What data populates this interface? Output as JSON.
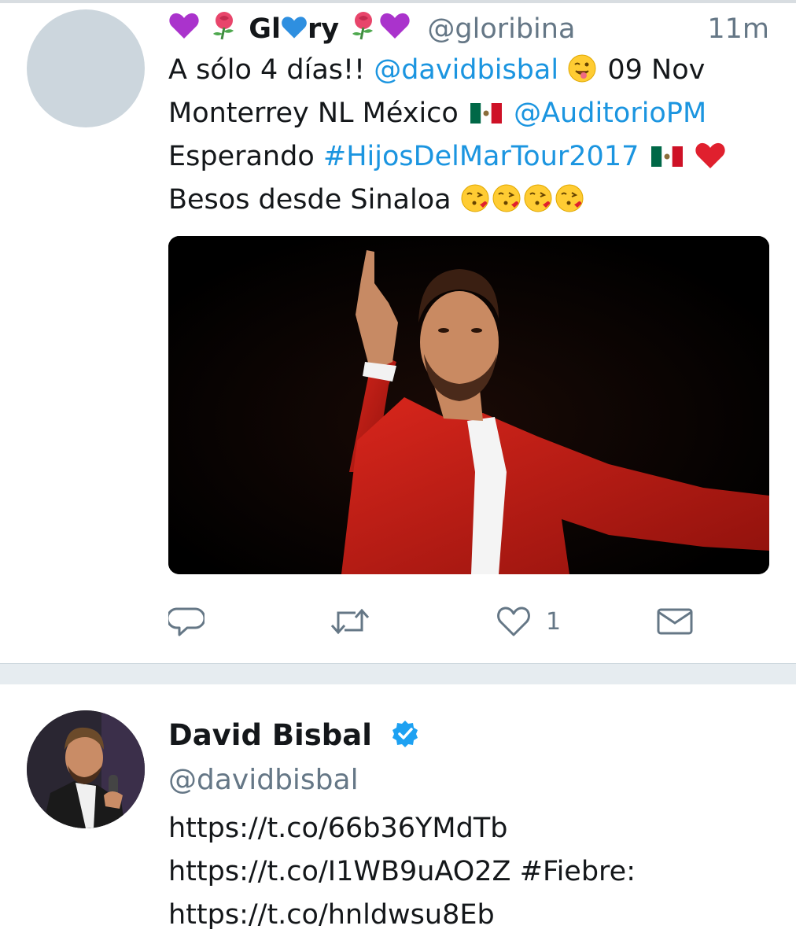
{
  "tweet1": {
    "display_name_part1": "Gl",
    "display_name_part2": "ry",
    "handle": "@gloribina",
    "time": "11m",
    "text": {
      "intro": "A sólo 4 días!! ",
      "mention_bisbal": "@davidbisbal",
      "date": " 09 Nov",
      "city": "Monterrey NL México ",
      "mention_auditorio": "@AuditorioPM",
      "waiting": "Esperando ",
      "hashtag": "#HijosDelMarTour2017",
      "greeting": "Besos desde Sinaloa "
    },
    "actions": {
      "like_count": "1"
    },
    "icons": [
      "reply-icon",
      "retweet-icon",
      "like-icon",
      "direct-message-icon"
    ]
  },
  "tweet2": {
    "display_name": "David Bisbal",
    "handle": "@davidbisbal",
    "url1": "https://t.co/66b36YMdTb",
    "url2": "https://t.co/I1WB9uAO2Z #Fiebre:",
    "url3": "https://t.co/hnldwsu8Eb"
  },
  "colors": {
    "link": "#1b95e0",
    "secondary_text": "#657786",
    "verified": "#1da1f2",
    "divider": "#e6ecf0"
  }
}
